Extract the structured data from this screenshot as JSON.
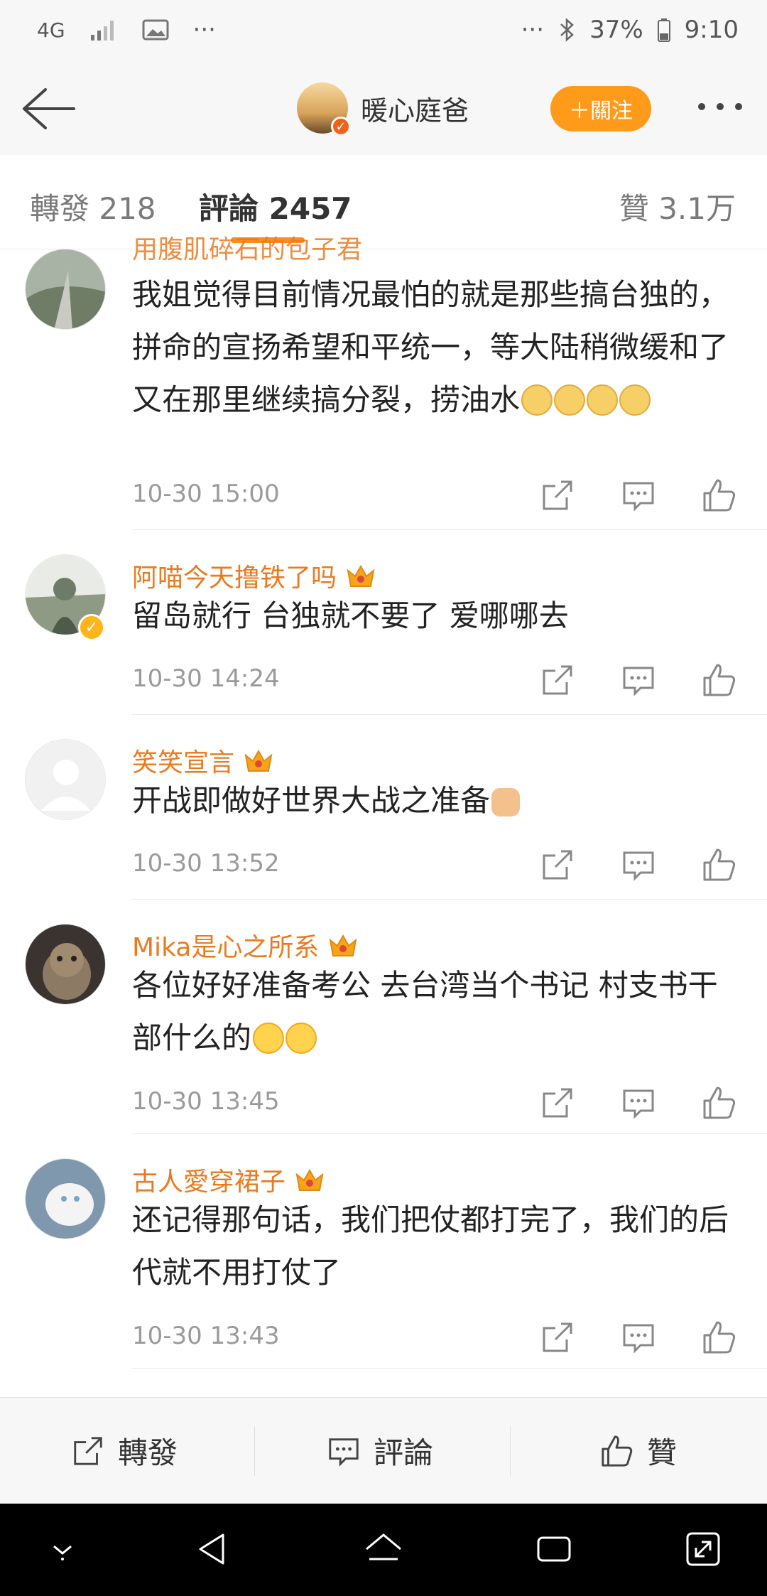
{
  "status_bar": {
    "network": "4G",
    "dots_left": "···",
    "dots_right": "···",
    "battery": "37%",
    "time": "9:10"
  },
  "navbar": {
    "account_name": "暖心庭爸",
    "follow_label": "＋關注"
  },
  "tabs": {
    "reposts": "轉發 218",
    "comments": "評論 2457",
    "likes": "贊 3.1万"
  },
  "comments": [
    {
      "name": "用腹肌碎石的包子君",
      "text": "我姐觉得目前情况最怕的就是那些搞台独的，拼命的宣扬希望和平统一，等大陆稍微缓和了又在那里继续搞分裂，捞油水",
      "time": "10-30 15:00"
    },
    {
      "name": "阿喵今天撸铁了吗",
      "text": "留岛就行  台独就不要了  爱哪哪去",
      "time": "10-30 14:24"
    },
    {
      "name": "笑笑宣言",
      "text": "开战即做好世界大战之准备",
      "time": "10-30 13:52"
    },
    {
      "name": "Mika是心之所系",
      "text": "各位好好准备考公 去台湾当个书记 村支书干部什么的",
      "time": "10-30 13:45"
    },
    {
      "name": "古人愛穿裙子",
      "text": "还记得那句话，我们把仗都打完了，我们的后代就不用打仗了",
      "time": "10-30 13:43"
    }
  ],
  "bottom_bar": {
    "repost": "轉發",
    "comment": "評論",
    "like": "贊"
  },
  "colors": {
    "accent_orange": "#ff9a1a",
    "username_orange": "#eb7a1f"
  }
}
